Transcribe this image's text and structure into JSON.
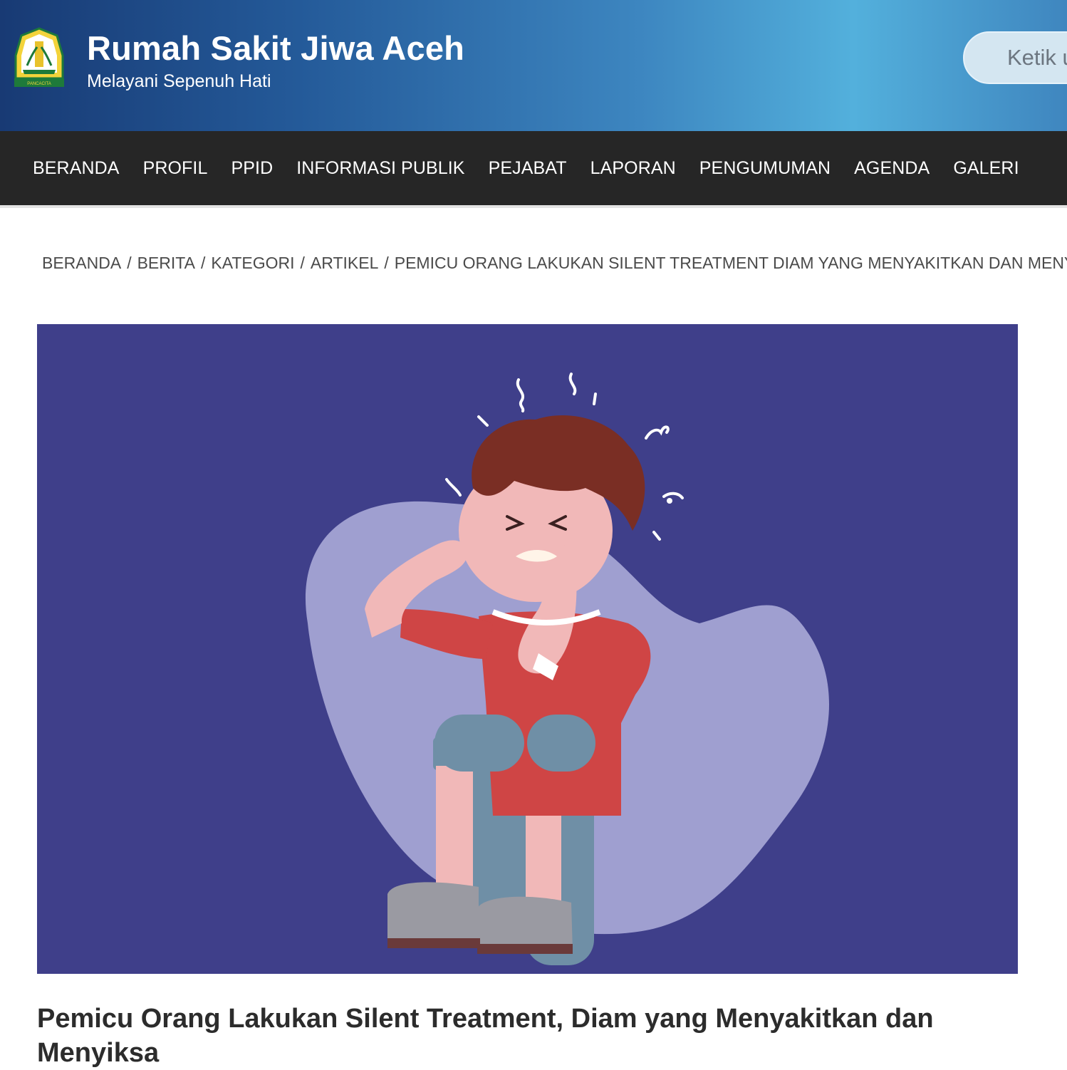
{
  "header": {
    "site_title": "Rumah Sakit Jiwa Aceh",
    "tagline": "Melayani Sepenuh Hati",
    "logo_caption": "PANCACITA",
    "search_placeholder": "Ketik untuk mencari..."
  },
  "nav": {
    "items": [
      {
        "label": "BERANDA"
      },
      {
        "label": "PROFIL"
      },
      {
        "label": "PPID"
      },
      {
        "label": "INFORMASI PUBLIK"
      },
      {
        "label": "PEJABAT"
      },
      {
        "label": "LAPORAN"
      },
      {
        "label": "PENGUMUMAN"
      },
      {
        "label": "AGENDA"
      },
      {
        "label": "GALERI"
      }
    ]
  },
  "breadcrumb": {
    "items": [
      {
        "label": "BERANDA"
      },
      {
        "label": "BERITA"
      },
      {
        "label": "KATEGORI"
      },
      {
        "label": "ARTIKEL"
      },
      {
        "label": "PEMICU ORANG LAKUKAN SILENT TREATMENT DIAM YANG MENYAKITKAN DAN MENYIKSA"
      }
    ],
    "separator": "/"
  },
  "article": {
    "title": "Pemicu Orang Lakukan Silent Treatment, Diam yang Menyakitkan dan Menyiksa"
  },
  "colors": {
    "header_gradient_start": "#183a74",
    "header_gradient_end": "#53b0dc",
    "nav_background": "#262626",
    "hero_background": "#3f3f8a"
  },
  "icons": {
    "home": "home-icon",
    "logo": "aceh-emblem-logo"
  }
}
